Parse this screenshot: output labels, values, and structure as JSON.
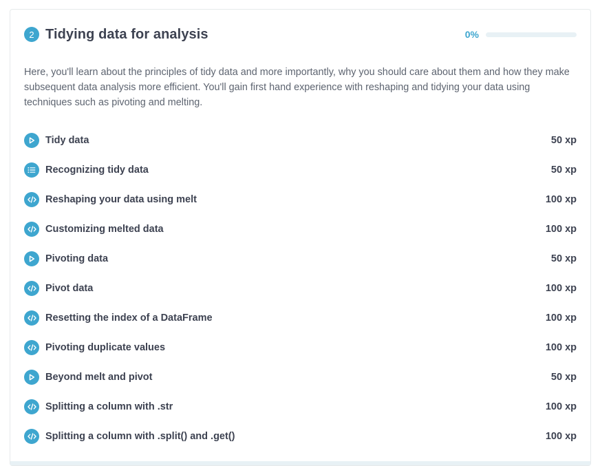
{
  "chapter": {
    "number": "2",
    "title": "Tidying data for analysis",
    "progress_label": "0%",
    "progress": 0,
    "description": "Here, you'll learn about the principles of tidy data and more importantly, why you should care about them and how they make subsequent data analysis more efficient. You'll gain first hand experience with reshaping and tidying your data using techniques such as pivoting and melting."
  },
  "colors": {
    "accent": "#3ea6cf",
    "text": "#3d4251",
    "muted": "#5d6470",
    "track": "#e8f1f5"
  },
  "lessons": [
    {
      "icon": "play-icon",
      "title": "Tidy data",
      "xp": "50 xp"
    },
    {
      "icon": "list-icon",
      "title": "Recognizing tidy data",
      "xp": "50 xp"
    },
    {
      "icon": "code-icon",
      "title": "Reshaping your data using melt",
      "xp": "100 xp"
    },
    {
      "icon": "code-icon",
      "title": "Customizing melted data",
      "xp": "100 xp"
    },
    {
      "icon": "play-icon",
      "title": "Pivoting data",
      "xp": "50 xp"
    },
    {
      "icon": "code-icon",
      "title": "Pivot data",
      "xp": "100 xp"
    },
    {
      "icon": "code-icon",
      "title": "Resetting the index of a DataFrame",
      "xp": "100 xp"
    },
    {
      "icon": "code-icon",
      "title": "Pivoting duplicate values",
      "xp": "100 xp"
    },
    {
      "icon": "play-icon",
      "title": "Beyond melt and pivot",
      "xp": "50 xp"
    },
    {
      "icon": "code-icon",
      "title": "Splitting a column with .str",
      "xp": "100 xp"
    },
    {
      "icon": "code-icon",
      "title": "Splitting a column with .split() and .get()",
      "xp": "100 xp"
    }
  ]
}
